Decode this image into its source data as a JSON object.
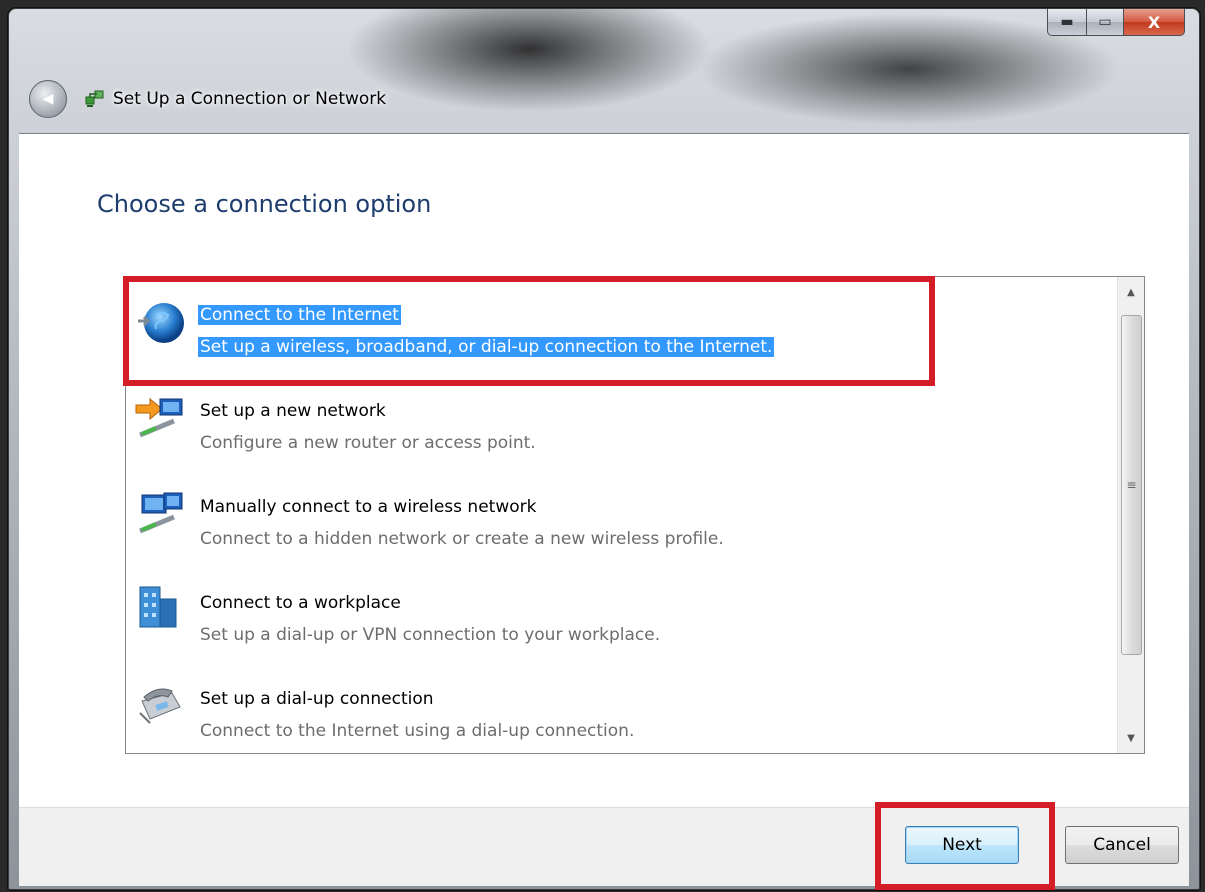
{
  "window": {
    "title": "Set Up a Connection or Network",
    "caption_buttons": {
      "minimize": "▬",
      "maximize": "▭",
      "close": "X"
    },
    "back_symbol": "◀"
  },
  "page": {
    "heading": "Choose a connection option"
  },
  "options": [
    {
      "title": "Connect to the Internet",
      "description": "Set up a wireless, broadband, or dial-up connection to the Internet.",
      "icon": "globe-icon",
      "selected": true
    },
    {
      "title": "Set up a new network",
      "description": "Configure a new router or access point.",
      "icon": "new-network-icon",
      "selected": false
    },
    {
      "title": "Manually connect to a wireless network",
      "description": "Connect to a hidden network or create a new wireless profile.",
      "icon": "wireless-network-icon",
      "selected": false
    },
    {
      "title": "Connect to a workplace",
      "description": "Set up a dial-up or VPN connection to your workplace.",
      "icon": "workplace-icon",
      "selected": false
    },
    {
      "title": "Set up a dial-up connection",
      "description": "Connect to the Internet using a dial-up connection.",
      "icon": "telephone-modem-icon",
      "selected": false
    }
  ],
  "scrollbar": {
    "up": "▲",
    "down": "▼",
    "grip": "≡"
  },
  "buttons": {
    "next": "Next",
    "cancel": "Cancel"
  },
  "colors": {
    "selection": "#3399ff",
    "heading": "#1e3d6e",
    "annotation": "#d51d28"
  }
}
